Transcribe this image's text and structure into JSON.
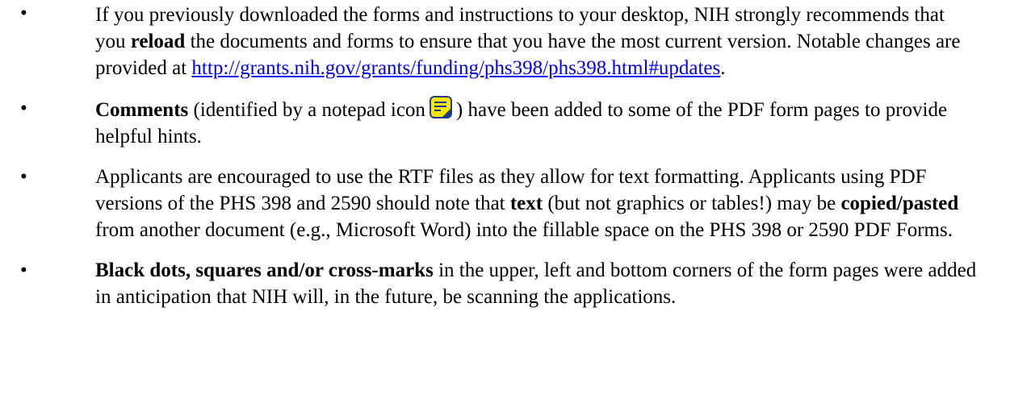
{
  "bullets": [
    {
      "symbol": "•",
      "text_a": "If you previously downloaded the forms and instructions to your desktop, NIH strongly recommends that you ",
      "bold_a": "reload",
      "text_b": " the documents and forms to ensure that you have the most current version. Notable changes are provided at ",
      "link": "http://grants.nih.gov/grants/funding/phs398/phs398.html#updates",
      "text_c": "."
    },
    {
      "symbol": "•",
      "bold_a": "Comments",
      "text_a": " (identified by a notepad icon",
      "icon": "notepad-icon",
      "text_b": ") have been added to some of the PDF form pages to provide helpful hints."
    },
    {
      "symbol": "•",
      "text_a": "Applicants are encouraged to use the RTF files as they allow for text formatting. Applicants using PDF versions of the PHS 398 and 2590 should note that ",
      "bold_a": "text",
      "text_b": " (but not graphics or tables!) may be ",
      "bold_b": "copied/pasted",
      "text_c": " from another document (e.g., Microsoft Word) into the fillable space on the PHS 398 or 2590 PDF Forms."
    },
    {
      "symbol": "•",
      "bold_a": "Black dots, squares and/or cross-marks",
      "text_a": " in the upper, left and bottom corners of the form pages were added in anticipation that NIH will, in the future, be scanning the applications."
    }
  ],
  "colors": {
    "link": "#0000ee",
    "icon_fill": "#ffe600",
    "icon_stroke": "#1a3f8c"
  }
}
